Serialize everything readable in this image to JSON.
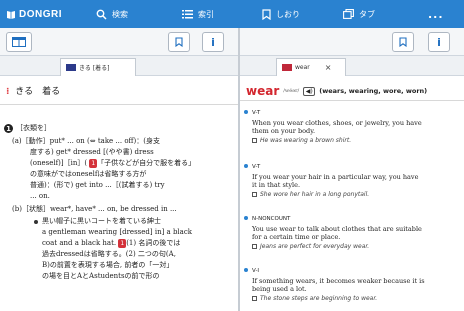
{
  "topbar": {
    "logo": "DONGRI",
    "search_label": "検索",
    "list_label": "索引",
    "bookmark_label": "しおり",
    "tabs_label": "タブ",
    "more_label": "..."
  },
  "left_pane": {
    "tab_label": "きる [着る]",
    "headword": "きる　着る",
    "lines": [
      "［衣類を］",
      "(a)［動作］put* ... on (⇔ take ... off)：(身支",
      "度する) get* dressed [(やや書) dress",
      "(oneself)]［in］(",
      "の意味がではoneselfは省略する方が",
      "普通)：(形で) get into ...［(試着する) try",
      "... on.",
      "(b)［状態］wear*, have* ... on, be dressed in ...",
      "黒い帽子に黒いコートを着ている紳士",
      "a gentleman wearing [dressed] in] a black",
      "coat and a black hat.",
      "(1) 名詞の後では",
      "過去dressedは省略する。(2) 二つの句(A,",
      "B)の前置を表現する場合, 前者の「一対」",
      "の場を目とAとAstudentsの前で形の"
    ],
    "inline_notes": {
      "badge_1": "1",
      "note_1": "「子供などが自分で服を着る」",
      "badge_2": "1"
    }
  },
  "right_pane": {
    "tab_label": "wear",
    "tab_close": "×",
    "headword": "wear",
    "pron": "/wéər/",
    "speaker": "◀)",
    "forms": "(wears, wearing, wore, worn)",
    "senses": [
      {
        "pos": "V-T",
        "def": [
          "When you wear clothes, shoes, or jewelry, you have",
          "them on your body."
        ],
        "example": "He was wearing a brown shirt."
      },
      {
        "pos": "V-T",
        "def": [
          "If you wear your hair in a particular way, you have",
          "it in that style."
        ],
        "example": "She wore her hair in a long ponytail."
      },
      {
        "pos": "N-NONCOUNT",
        "def": [
          "You use wear to talk about clothes that are suitable",
          "for a certain time or place."
        ],
        "example": "Jeans are perfect for everyday wear."
      },
      {
        "pos": "V-I",
        "def": [
          "If something wears, it becomes weaker because it is",
          "being used a lot."
        ],
        "example": "The stone steps are beginning to wear."
      }
    ]
  },
  "colors": {
    "topbar": "#2a82d0",
    "accent_red": "#d3272f"
  }
}
